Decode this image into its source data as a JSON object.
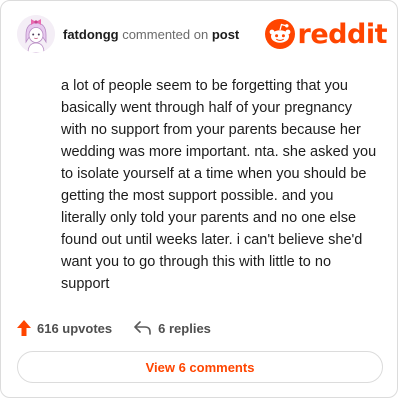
{
  "header": {
    "username": "fatdongg",
    "action_text": " commented on ",
    "object_text": "post",
    "logo_text": "reddit"
  },
  "comment": {
    "text": "a lot of people seem to be forgetting that you basically went through half of your pregnancy with no support from your parents because her wedding was more important. nta. she asked you to isolate yourself at a time when you should be getting the most support possible. and you literally only told your parents and no one else found out until weeks later. i can't believe she'd want you to go through this with little to no support"
  },
  "stats": {
    "upvotes": "616 upvotes",
    "replies": "6 replies"
  },
  "footer": {
    "view_comments_label": "View 6 comments"
  },
  "colors": {
    "brand": "#ff4500",
    "text": "#1c1c1c",
    "muted": "#6b6b6b",
    "border": "#dcdcdc"
  },
  "icons": {
    "upvote": "upvote-arrow-icon",
    "reply": "reply-arrow-icon",
    "logo": "snoo-icon"
  }
}
